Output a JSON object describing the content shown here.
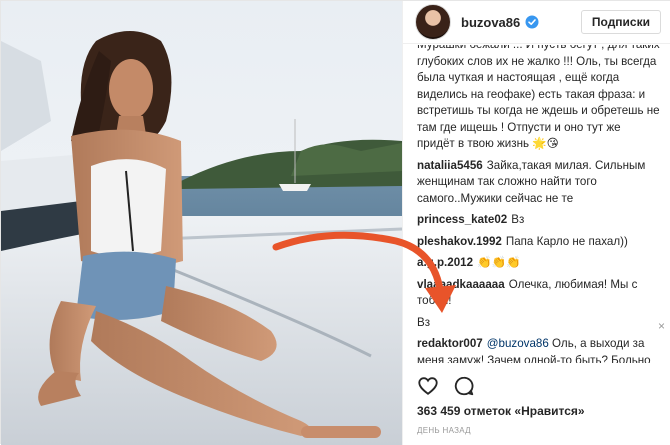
{
  "header": {
    "username": "buzova86",
    "follow_label": "Подписки"
  },
  "comments": [
    {
      "author": "",
      "text": "Мурашки бежали ... И пусть бегут , для таких глубоких слов их не жалко !!! Оль, ты всегда была чуткая и настоящая , ещё когда виделись на геофаке) есть такая фраза: и встретишь ты когда не ждешь и обретешь не там где ищешь ! Отпусти и оно тут же придёт в твою жизнь 🌟😘"
    },
    {
      "author": "nataliia5456",
      "text": "Зайка,такая милая. Сильным женщинам так сложно найти того самого..Мужики сейчас не те"
    },
    {
      "author": "princess_kate02",
      "text": "Вз"
    },
    {
      "author": "pleshakov.1992",
      "text": "Папа Карло не пахал))"
    },
    {
      "author": "a.g.p.2012",
      "text": "👏👏👏"
    },
    {
      "author": "vlaaaadkaaaaaa",
      "text": "Олечка, любимая! Мы с тобой!"
    },
    {
      "author": "",
      "text": "Вз"
    },
    {
      "author": "redaktor007",
      "mention": "@buzova86",
      "text": "Оль, а выходи за меня замуж! Зачем одной-то быть? Больно не сделаю точно!)"
    }
  ],
  "delete_icon": "×",
  "likes": "363 459 отметок «Нравится»",
  "timestamp": "ДЕНЬ НАЗАД",
  "colors": {
    "arrow": "#e8542a",
    "verified": "#3897f0",
    "border": "#efefef"
  }
}
